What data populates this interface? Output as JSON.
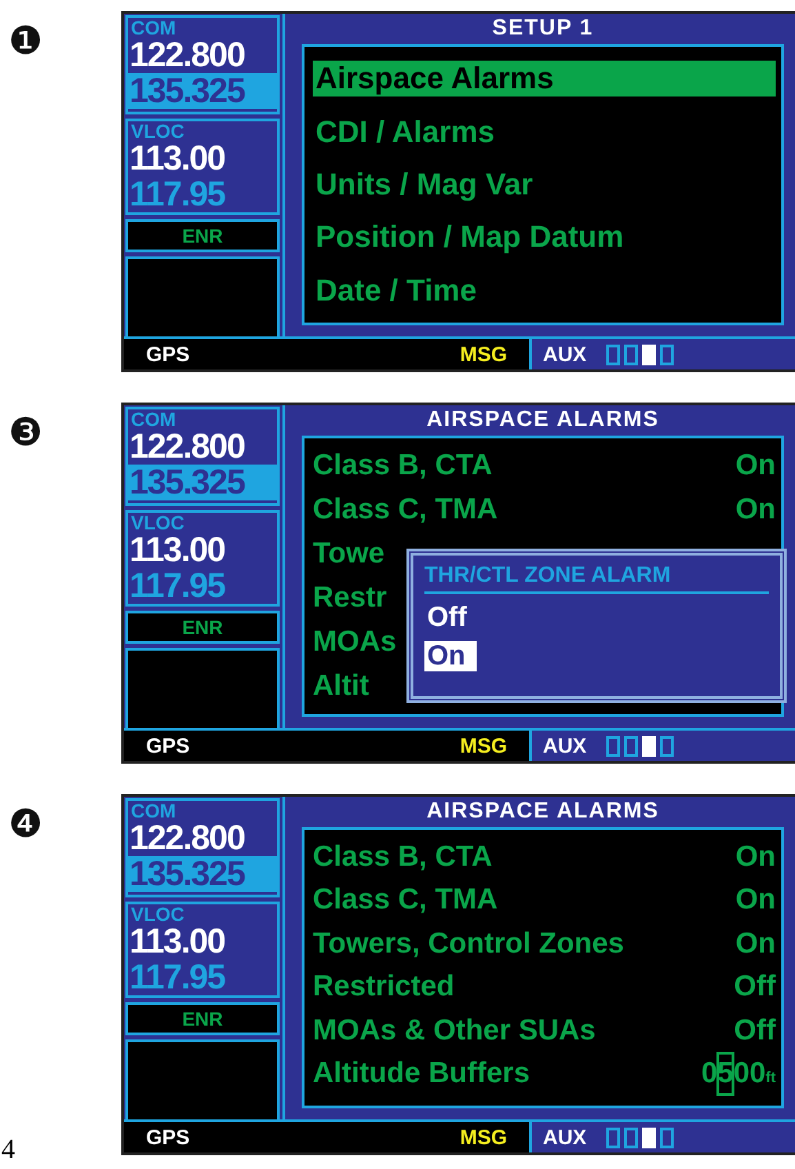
{
  "panels": [
    {
      "step": "❶",
      "com_label": "COM",
      "com_active": "122.800",
      "com_standby": "135.325",
      "vloc_label": "VLOC",
      "vloc_active": "113.00",
      "vloc_standby": "117.95",
      "mode": "ENR",
      "title": "SETUP 1",
      "kind": "menu",
      "items": [
        {
          "label": "Airspace Alarms",
          "selected": true
        },
        {
          "label": "CDI / Alarms",
          "selected": false
        },
        {
          "label": "Units / Mag Var",
          "selected": false
        },
        {
          "label": "Position / Map Datum",
          "selected": false
        },
        {
          "label": "Date / Time",
          "selected": false
        }
      ],
      "status_bar": {
        "left": "GPS",
        "msg": "MSG",
        "aux": "AUX",
        "page_dots": [
          {
            "selected": false
          },
          {
            "selected": false
          },
          {
            "selected": true
          },
          {
            "selected": false
          }
        ]
      }
    },
    {
      "step": "❸",
      "com_label": "COM",
      "com_active": "122.800",
      "com_standby": "135.325",
      "vloc_label": "VLOC",
      "vloc_active": "113.00",
      "vloc_standby": "117.95",
      "mode": "ENR",
      "title": "AIRSPACE ALARMS",
      "kind": "settings",
      "rows": [
        {
          "label": "Class B, CTA",
          "value": "On"
        },
        {
          "label": "Class C, TMA",
          "value": "On"
        },
        {
          "label": "Towe"
        },
        {
          "label": "Restr"
        },
        {
          "label": "MOAs"
        },
        {
          "label": "Altit"
        }
      ],
      "popup": {
        "title": "THR/CTL ZONE ALARM",
        "options": [
          {
            "label": "Off",
            "selected": false
          },
          {
            "label": "On",
            "selected": true
          }
        ]
      },
      "status_bar": {
        "left": "GPS",
        "msg": "MSG",
        "aux": "AUX",
        "page_dots": [
          {
            "selected": false
          },
          {
            "selected": false
          },
          {
            "selected": true
          },
          {
            "selected": false
          }
        ]
      }
    },
    {
      "step": "❹",
      "com_label": "COM",
      "com_active": "122.800",
      "com_standby": "135.325",
      "vloc_label": "VLOC",
      "vloc_active": "113.00",
      "vloc_standby": "117.95",
      "mode": "ENR",
      "title": "AIRSPACE ALARMS",
      "kind": "settings",
      "rows": [
        {
          "label": "Class B, CTA",
          "value": "On"
        },
        {
          "label": "Class C, TMA",
          "value": "On"
        },
        {
          "label": "Towers, Control Zones",
          "value": "On"
        },
        {
          "label": "Restricted",
          "value": "Off"
        },
        {
          "label": "MOAs & Other SUAs",
          "value": "Off"
        },
        {
          "label": "Altitude Buffers",
          "value_parts": [
            {
              "text": "0",
              "selected": false
            },
            {
              "text": "5",
              "selected": true
            },
            {
              "text": "00",
              "selected": false
            }
          ],
          "unit": "ft"
        }
      ],
      "status_bar": {
        "left": "GPS",
        "msg": "MSG",
        "aux": "AUX",
        "page_dots": [
          {
            "selected": false
          },
          {
            "selected": false
          },
          {
            "selected": true
          },
          {
            "selected": false
          }
        ]
      }
    }
  ],
  "page_number": "4"
}
